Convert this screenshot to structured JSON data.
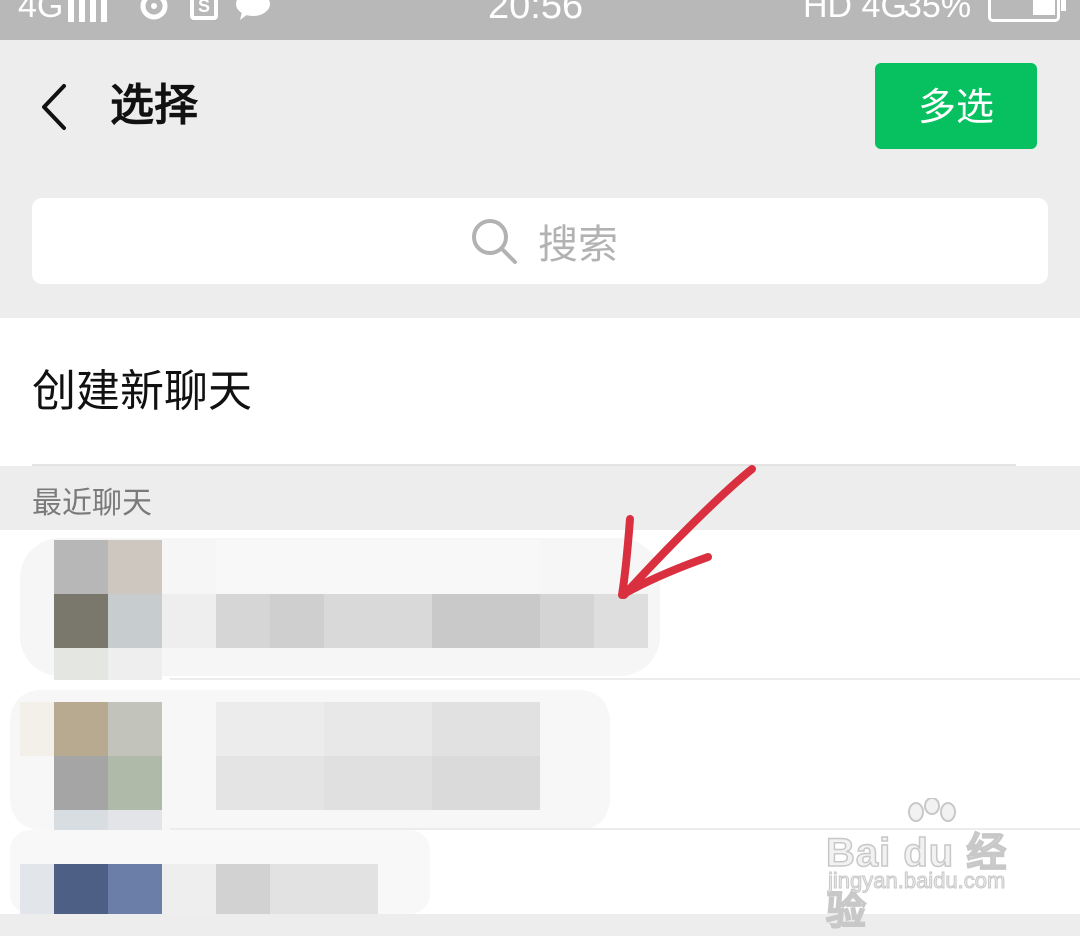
{
  "status_bar": {
    "network": "4G",
    "time": "20:56",
    "hd_network": "HD 4G",
    "battery": "35%"
  },
  "header": {
    "title": "选择",
    "multi_select_label": "多选"
  },
  "search": {
    "placeholder": "搜索"
  },
  "create_chat": {
    "label": "创建新聊天"
  },
  "recent": {
    "section_label": "最近聊天",
    "items_blurred": true
  },
  "colors": {
    "accent_green": "#07c160",
    "annotation_red": "#d92f3e",
    "background": "#ededed"
  },
  "watermark": {
    "logo": "Bai du 经验",
    "url": "jingyan.baidu.com"
  }
}
